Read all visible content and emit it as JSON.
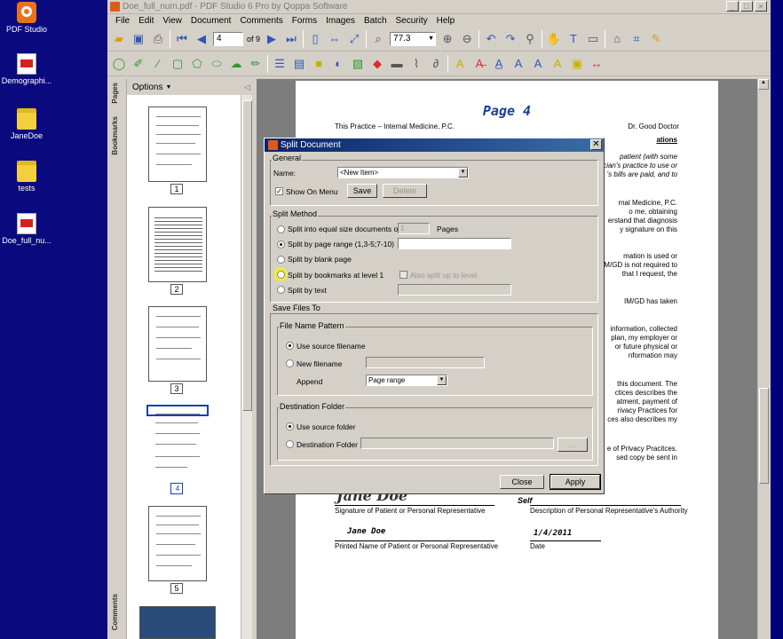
{
  "desktop": {
    "icons": [
      {
        "label": "PDF Studio",
        "kind": "app"
      },
      {
        "label": "Demographi...",
        "kind": "pdf"
      },
      {
        "label": "JaneDoe",
        "kind": "folder"
      },
      {
        "label": "tests",
        "kind": "folder"
      },
      {
        "label": "Doe_full_nu...",
        "kind": "pdf"
      }
    ]
  },
  "window": {
    "title": "Doe_full_num.pdf - PDF Studio 6 Pro by Qoppa Software",
    "min": "_",
    "max": "□",
    "close": "×"
  },
  "menu": [
    "File",
    "Edit",
    "View",
    "Document",
    "Comments",
    "Forms",
    "Images",
    "Batch",
    "Security",
    "Help"
  ],
  "toolbar": {
    "page_current": "4",
    "page_of": "of 9",
    "zoom": "77.3"
  },
  "side": {
    "tab_pages": "Pages",
    "tab_bookmarks": "Bookmarks",
    "tab_comments": "Comments",
    "options": "Options",
    "thumb_numbers": [
      "1",
      "2",
      "3",
      "4",
      "5"
    ]
  },
  "page": {
    "heading": "Page 4",
    "practice": "This Practice – Internal Medicine, P.C.",
    "doctor": "Dr. Good Doctor",
    "right_lines": [
      "ations",
      "patient (with some",
      "cian's practice to use or",
      "'s bills are paid, and to",
      "rnal Medicine, P.C.",
      "o me, obtaining",
      "erstand that diagnosis",
      "y signature on this",
      "mation is used or",
      "IM/GD is not required to",
      "that I request, the",
      "IM/GD has taken",
      "information, collected",
      "plan, my employer or",
      "or future physical or",
      "nformation may",
      "this document.  The",
      "ctices describes the",
      "atment, payment of",
      "rivacy Practices for",
      "ces also describes my",
      "e of Privacy Pracitces.",
      "sed copy be sent in"
    ],
    "sig_cursive": "Jane Doe",
    "sig_label": "Signature of Patient or Personal Representative",
    "self": "Self",
    "rel_label": "Description of Personal Representative's Authority",
    "printed_name": "Jane Doe",
    "printed_label": "Printed Name of Patient or Personal Representative",
    "date_value": "1/4/2011",
    "date_label": "Date"
  },
  "dialog": {
    "title": "Split Document",
    "general": "General",
    "name_label": "Name:",
    "name_value": "<New Item>",
    "show_on_menu": "Show On Menu",
    "save": "Save",
    "delete": "Delete",
    "split_method": "Split Method",
    "opt_equal": "Split into equal size documents of",
    "equal_value": "1",
    "pages": "Pages",
    "opt_range": "Split by page range (1,3-5;7-10)",
    "opt_blank": "Split by blank page",
    "opt_bookmarks": "Split by bookmarks at level 1",
    "also_split": "Also split up to level",
    "opt_text": "Split by text",
    "save_files_to": "Save Files To",
    "file_name_pattern": "File Name Pattern",
    "use_source_filename": "Use source filename",
    "new_filename": "New filename",
    "append": "Append",
    "append_value": "Page range",
    "destination_folder": "Destination Folder",
    "use_source_folder": "Use source folder",
    "dest_folder_opt": "Destination Folder",
    "browse": "...",
    "close": "Close",
    "apply": "Apply"
  }
}
